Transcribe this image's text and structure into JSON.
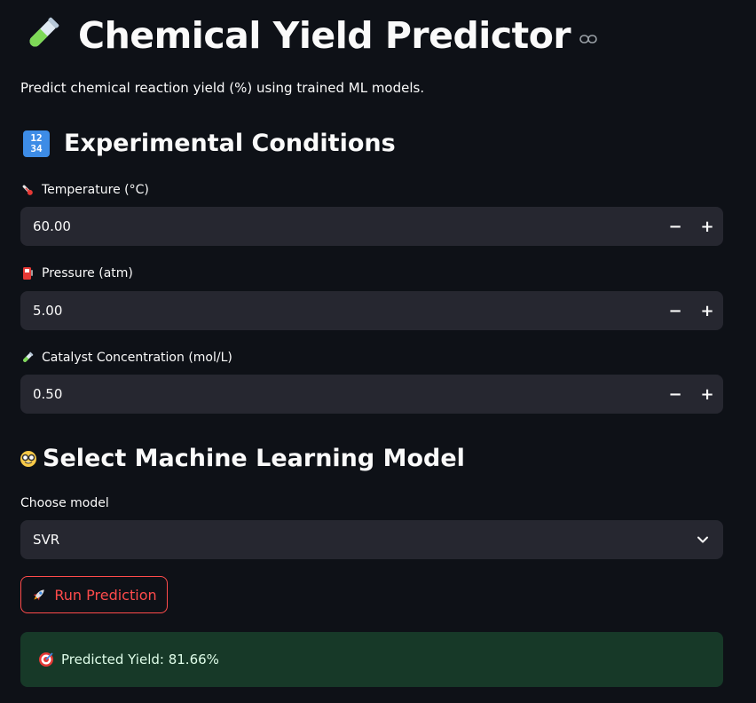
{
  "title": "Chemical Yield Predictor",
  "subtitle": "Predict chemical reaction yield (%) using trained ML models.",
  "conditions": {
    "heading": "Experimental Conditions",
    "heading_icon_lines": [
      "12",
      "34"
    ],
    "temperature": {
      "label": "Temperature (°C)",
      "value": "60.00",
      "icon": "thermometer-icon"
    },
    "pressure": {
      "label": "Pressure (atm)",
      "value": "5.00",
      "icon": "fuel-pump-icon"
    },
    "catalyst": {
      "label": "Catalyst Concentration (mol/L)",
      "value": "0.50",
      "icon": "test-tube-icon"
    },
    "decrement_symbol": "−",
    "increment_symbol": "+"
  },
  "model": {
    "heading": "Select Machine Learning Model",
    "label": "Choose model",
    "selected": "SVR"
  },
  "run_button": {
    "label": "Run Prediction",
    "icon": "rocket-icon"
  },
  "result": {
    "text": "Predicted Yield: 81.66%",
    "icon": "target-icon"
  },
  "colors": {
    "background": "#0e1117",
    "input_bg": "#262730",
    "accent_red": "#ff4b4b",
    "success_bg": "#173928",
    "number_icon_blue": "#3d8ce6"
  }
}
